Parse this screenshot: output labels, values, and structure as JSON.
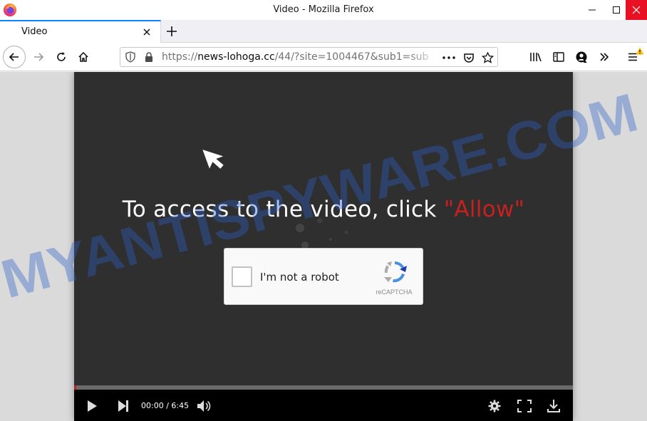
{
  "window": {
    "title": "Video - Mozilla Firefox"
  },
  "tabs": [
    {
      "label": "Video",
      "active": true
    }
  ],
  "urlbar": {
    "scheme": "https://",
    "host": "news-lohoga.cc",
    "path": "/44/?site=1004467&sub1=sub"
  },
  "page": {
    "prompt_text": "To access to the video, click ",
    "prompt_allow": "\"Allow\""
  },
  "captcha": {
    "label": "I'm not a robot",
    "brand": "reCAPTCHA",
    "checked": false
  },
  "player": {
    "time": "00:00 / 6:45",
    "progress_fraction": 0.003
  },
  "watermark": {
    "text": "MYANTISPYWARE.COM"
  },
  "colors": {
    "accent": "#0a84ff",
    "allow_red": "#c8201f",
    "close_red": "#e81123",
    "player_bg": "#2f2f2f",
    "watermark_blue": "#2c5fc9"
  },
  "icons": {
    "window": [
      "firefox-logo-icon",
      "minimize-icon",
      "maximize-icon",
      "close-icon"
    ],
    "nav": [
      "back-arrow-icon",
      "forward-arrow-icon",
      "reload-icon",
      "home-icon",
      "shield-icon",
      "lock-icon",
      "more-dots-icon",
      "pocket-icon",
      "star-icon",
      "library-icon",
      "sidebar-icon",
      "account-icon",
      "overflow-chevrons-icon",
      "hamburger-menu-icon",
      "warning-icon"
    ],
    "player": [
      "play-icon",
      "skip-next-icon",
      "volume-icon",
      "gear-icon",
      "fullscreen-icon",
      "download-icon"
    ]
  }
}
